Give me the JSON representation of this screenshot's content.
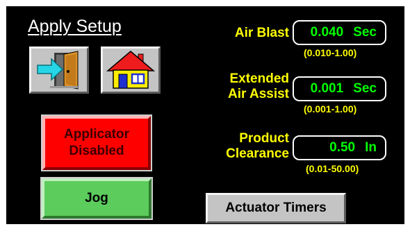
{
  "screen": {
    "title": "Apply Setup"
  },
  "nav": {
    "exit_icon": "exit-door-arrow-icon",
    "home_icon": "home-house-icon"
  },
  "buttons": {
    "applicator_line1": "Applicator",
    "applicator_line2": "Disabled",
    "jog": "Jog",
    "actuator_timers": "Actuator Timers"
  },
  "params": {
    "air_blast": {
      "label": "Air Blast",
      "value": "0.040",
      "unit": "Sec",
      "range": "(0.010-1.00)"
    },
    "extended_air_assist": {
      "label_line1": "Extended",
      "label_line2": "Air Assist",
      "value": "0.001",
      "unit": "Sec",
      "range": "(0.001-1.00)"
    },
    "product_clearance": {
      "label_line1": "Product",
      "label_line2": "Clearance",
      "value": "0.50",
      "unit": "In",
      "range": "(0.01-50.00)"
    }
  },
  "colors": {
    "background": "#000000",
    "label": "#ffff00",
    "value": "#00ff00",
    "applicator_disabled": "#ff0000",
    "jog": "#5ccc5c",
    "button_gray": "#c4c4c4"
  }
}
